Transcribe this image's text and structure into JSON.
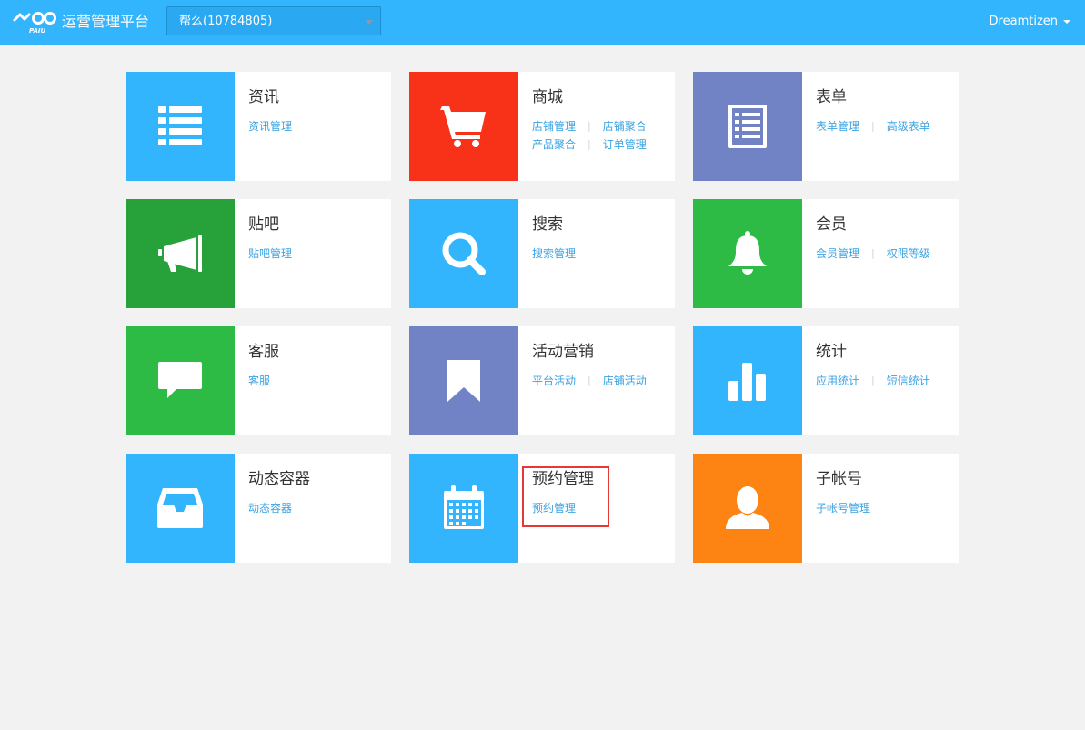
{
  "header": {
    "app_title": "运营管理平台",
    "selector_value": "帮么(10784805)",
    "user_name": "Dreamtizen",
    "logo_text": "PAIU"
  },
  "colors": {
    "topbar": "#33b5fd",
    "blue": "#33b5fd",
    "red": "#f73219",
    "purple": "#7183c4",
    "dark_green": "#27a23a",
    "green": "#2dba45",
    "orange": "#fd8312"
  },
  "modules": [
    {
      "title": "资讯",
      "icon": "list-icon",
      "color": "blue",
      "links": [
        [
          "资讯管理"
        ]
      ]
    },
    {
      "title": "商城",
      "icon": "cart-icon",
      "color": "red",
      "links": [
        [
          "店铺管理",
          "店铺聚合"
        ],
        [
          "产品聚合",
          "订单管理"
        ]
      ]
    },
    {
      "title": "表单",
      "icon": "form-icon",
      "color": "purple",
      "links": [
        [
          "表单管理",
          "高级表单"
        ]
      ]
    },
    {
      "title": "贴吧",
      "icon": "megaphone-icon",
      "color": "dark_green",
      "links": [
        [
          "贴吧管理"
        ]
      ]
    },
    {
      "title": "搜索",
      "icon": "search-icon",
      "color": "blue",
      "links": [
        [
          "搜索管理"
        ]
      ]
    },
    {
      "title": "会员",
      "icon": "bell-icon",
      "color": "green",
      "links": [
        [
          "会员管理",
          "权限等级"
        ]
      ]
    },
    {
      "title": "客服",
      "icon": "chat-icon",
      "color": "green",
      "links": [
        [
          "客服"
        ]
      ]
    },
    {
      "title": "活动营销",
      "icon": "bookmark-icon",
      "color": "purple",
      "links": [
        [
          "平台活动",
          "店铺活动"
        ]
      ]
    },
    {
      "title": "统计",
      "icon": "bar-chart-icon",
      "color": "blue",
      "links": [
        [
          "应用统计",
          "短信统计"
        ]
      ]
    },
    {
      "title": "动态容器",
      "icon": "inbox-icon",
      "color": "blue",
      "links": [
        [
          "动态容器"
        ]
      ]
    },
    {
      "title": "预约管理",
      "icon": "calendar-icon",
      "color": "blue",
      "links": [
        [
          "预约管理"
        ]
      ]
    },
    {
      "title": "子帐号",
      "icon": "user-icon",
      "color": "orange",
      "links": [
        [
          "子帐号管理"
        ]
      ]
    }
  ]
}
